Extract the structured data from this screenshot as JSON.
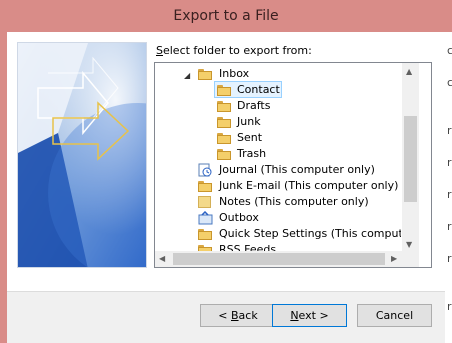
{
  "window": {
    "title": "Export to a File"
  },
  "prompt": {
    "pre": "",
    "accel": "S",
    "post": "elect folder to export from:"
  },
  "tree": {
    "items": [
      {
        "label": "Inbox",
        "expander": "◢",
        "icon": "inbox-folder-icon"
      },
      {
        "label": "Contact",
        "icon": "folder-icon",
        "selected": true
      },
      {
        "label": "Drafts",
        "icon": "folder-icon"
      },
      {
        "label": "Junk",
        "icon": "folder-icon"
      },
      {
        "label": "Sent",
        "icon": "folder-icon"
      },
      {
        "label": "Trash",
        "icon": "folder-icon"
      },
      {
        "label": "Journal (This computer only)",
        "icon": "journal-icon"
      },
      {
        "label": "Junk E-mail (This computer only)",
        "icon": "folder-icon"
      },
      {
        "label": "Notes (This computer only)",
        "icon": "notes-icon"
      },
      {
        "label": "Outbox",
        "icon": "outbox-icon"
      },
      {
        "label": "Quick Step Settings (This computer o",
        "icon": "folder-icon"
      },
      {
        "label": "RSS Feeds",
        "icon": "folder-icon"
      }
    ]
  },
  "buttons": {
    "back": {
      "pre": "< ",
      "accel": "B",
      "post": "ack"
    },
    "next": {
      "pre": "",
      "accel": "N",
      "post": "ext >"
    },
    "cancel": "Cancel"
  },
  "edge_glyphs": [
    "c",
    "c",
    "r",
    "r",
    "r",
    "r",
    "r",
    "r"
  ],
  "colors": {
    "title_bar": "#d98c88",
    "selection": "#e5f3ff",
    "default_button_border": "#0078d7"
  }
}
